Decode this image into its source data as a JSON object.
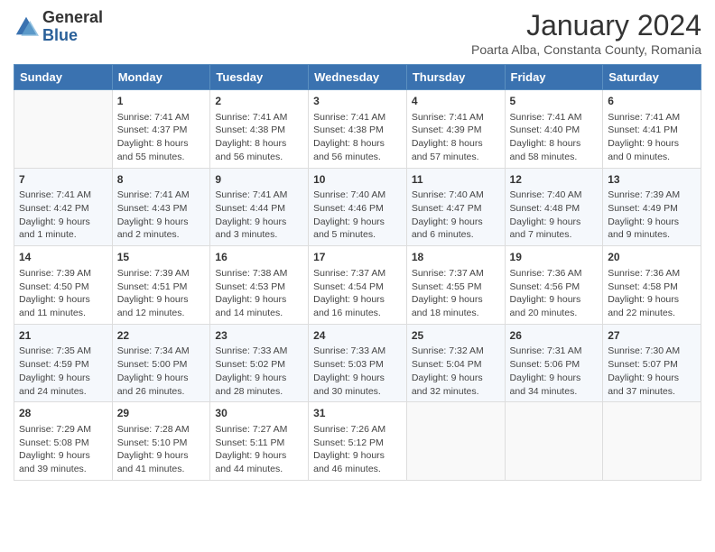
{
  "header": {
    "logo_general": "General",
    "logo_blue": "Blue",
    "month_title": "January 2024",
    "subtitle": "Poarta Alba, Constanta County, Romania"
  },
  "days_of_week": [
    "Sunday",
    "Monday",
    "Tuesday",
    "Wednesday",
    "Thursday",
    "Friday",
    "Saturday"
  ],
  "weeks": [
    [
      {
        "day": "",
        "info": ""
      },
      {
        "day": "1",
        "info": "Sunrise: 7:41 AM\nSunset: 4:37 PM\nDaylight: 8 hours\nand 55 minutes."
      },
      {
        "day": "2",
        "info": "Sunrise: 7:41 AM\nSunset: 4:38 PM\nDaylight: 8 hours\nand 56 minutes."
      },
      {
        "day": "3",
        "info": "Sunrise: 7:41 AM\nSunset: 4:38 PM\nDaylight: 8 hours\nand 56 minutes."
      },
      {
        "day": "4",
        "info": "Sunrise: 7:41 AM\nSunset: 4:39 PM\nDaylight: 8 hours\nand 57 minutes."
      },
      {
        "day": "5",
        "info": "Sunrise: 7:41 AM\nSunset: 4:40 PM\nDaylight: 8 hours\nand 58 minutes."
      },
      {
        "day": "6",
        "info": "Sunrise: 7:41 AM\nSunset: 4:41 PM\nDaylight: 9 hours\nand 0 minutes."
      }
    ],
    [
      {
        "day": "7",
        "info": "Sunrise: 7:41 AM\nSunset: 4:42 PM\nDaylight: 9 hours\nand 1 minute."
      },
      {
        "day": "8",
        "info": "Sunrise: 7:41 AM\nSunset: 4:43 PM\nDaylight: 9 hours\nand 2 minutes."
      },
      {
        "day": "9",
        "info": "Sunrise: 7:41 AM\nSunset: 4:44 PM\nDaylight: 9 hours\nand 3 minutes."
      },
      {
        "day": "10",
        "info": "Sunrise: 7:40 AM\nSunset: 4:46 PM\nDaylight: 9 hours\nand 5 minutes."
      },
      {
        "day": "11",
        "info": "Sunrise: 7:40 AM\nSunset: 4:47 PM\nDaylight: 9 hours\nand 6 minutes."
      },
      {
        "day": "12",
        "info": "Sunrise: 7:40 AM\nSunset: 4:48 PM\nDaylight: 9 hours\nand 7 minutes."
      },
      {
        "day": "13",
        "info": "Sunrise: 7:39 AM\nSunset: 4:49 PM\nDaylight: 9 hours\nand 9 minutes."
      }
    ],
    [
      {
        "day": "14",
        "info": "Sunrise: 7:39 AM\nSunset: 4:50 PM\nDaylight: 9 hours\nand 11 minutes."
      },
      {
        "day": "15",
        "info": "Sunrise: 7:39 AM\nSunset: 4:51 PM\nDaylight: 9 hours\nand 12 minutes."
      },
      {
        "day": "16",
        "info": "Sunrise: 7:38 AM\nSunset: 4:53 PM\nDaylight: 9 hours\nand 14 minutes."
      },
      {
        "day": "17",
        "info": "Sunrise: 7:37 AM\nSunset: 4:54 PM\nDaylight: 9 hours\nand 16 minutes."
      },
      {
        "day": "18",
        "info": "Sunrise: 7:37 AM\nSunset: 4:55 PM\nDaylight: 9 hours\nand 18 minutes."
      },
      {
        "day": "19",
        "info": "Sunrise: 7:36 AM\nSunset: 4:56 PM\nDaylight: 9 hours\nand 20 minutes."
      },
      {
        "day": "20",
        "info": "Sunrise: 7:36 AM\nSunset: 4:58 PM\nDaylight: 9 hours\nand 22 minutes."
      }
    ],
    [
      {
        "day": "21",
        "info": "Sunrise: 7:35 AM\nSunset: 4:59 PM\nDaylight: 9 hours\nand 24 minutes."
      },
      {
        "day": "22",
        "info": "Sunrise: 7:34 AM\nSunset: 5:00 PM\nDaylight: 9 hours\nand 26 minutes."
      },
      {
        "day": "23",
        "info": "Sunrise: 7:33 AM\nSunset: 5:02 PM\nDaylight: 9 hours\nand 28 minutes."
      },
      {
        "day": "24",
        "info": "Sunrise: 7:33 AM\nSunset: 5:03 PM\nDaylight: 9 hours\nand 30 minutes."
      },
      {
        "day": "25",
        "info": "Sunrise: 7:32 AM\nSunset: 5:04 PM\nDaylight: 9 hours\nand 32 minutes."
      },
      {
        "day": "26",
        "info": "Sunrise: 7:31 AM\nSunset: 5:06 PM\nDaylight: 9 hours\nand 34 minutes."
      },
      {
        "day": "27",
        "info": "Sunrise: 7:30 AM\nSunset: 5:07 PM\nDaylight: 9 hours\nand 37 minutes."
      }
    ],
    [
      {
        "day": "28",
        "info": "Sunrise: 7:29 AM\nSunset: 5:08 PM\nDaylight: 9 hours\nand 39 minutes."
      },
      {
        "day": "29",
        "info": "Sunrise: 7:28 AM\nSunset: 5:10 PM\nDaylight: 9 hours\nand 41 minutes."
      },
      {
        "day": "30",
        "info": "Sunrise: 7:27 AM\nSunset: 5:11 PM\nDaylight: 9 hours\nand 44 minutes."
      },
      {
        "day": "31",
        "info": "Sunrise: 7:26 AM\nSunset: 5:12 PM\nDaylight: 9 hours\nand 46 minutes."
      },
      {
        "day": "",
        "info": ""
      },
      {
        "day": "",
        "info": ""
      },
      {
        "day": "",
        "info": ""
      }
    ]
  ]
}
